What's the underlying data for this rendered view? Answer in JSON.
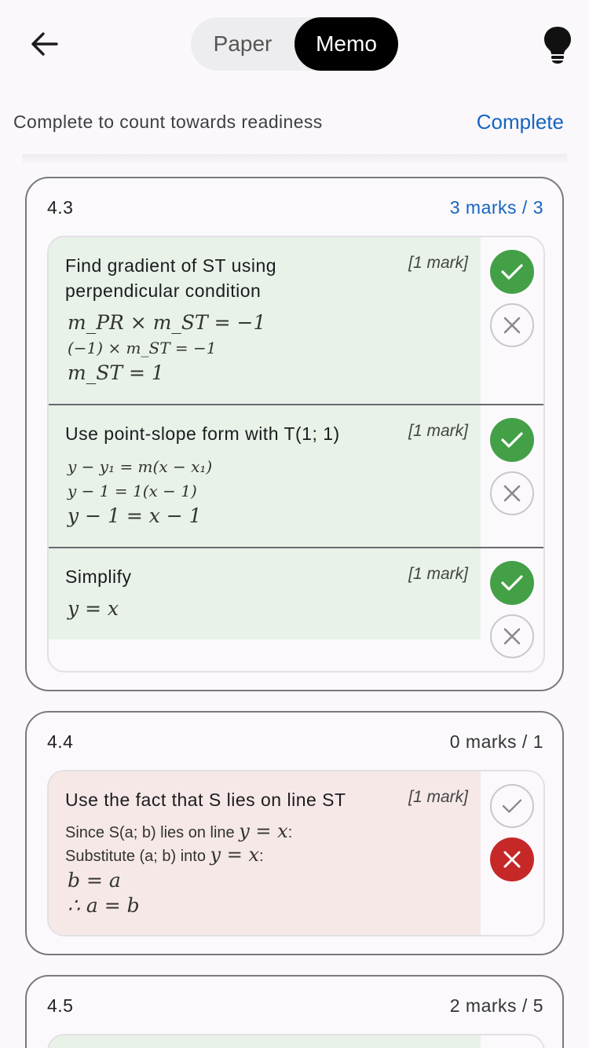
{
  "header": {
    "back_icon": "arrow-left-icon",
    "segments": [
      "Paper",
      "Memo"
    ],
    "active_segment": "Memo",
    "hint_icon": "lightbulb-icon"
  },
  "readiness": {
    "text": "Complete to count towards readiness",
    "action": "Complete"
  },
  "questions": [
    {
      "number": "4.3",
      "marks": "3 marks / 3",
      "steps": [
        {
          "title": "Find gradient of ST using perpendicular condition",
          "mark": "[1 mark]",
          "lines": [
            "m_PR × m_ST = −1",
            "(−1) × m_ST = −1",
            "m_ST = 1"
          ],
          "status": "correct"
        },
        {
          "title": "Use point-slope form with T(1; 1)",
          "mark": "[1 mark]",
          "lines": [
            "y − y₁ = m(x − x₁)",
            "y − 1 = 1(x − 1)",
            "y − 1 = x − 1"
          ],
          "status": "correct"
        },
        {
          "title": "Simplify",
          "mark": "[1 mark]",
          "lines": [
            "y = x"
          ],
          "status": "correct"
        }
      ]
    },
    {
      "number": "4.4",
      "marks": "0 marks / 1",
      "steps": [
        {
          "title": "Use the fact that S lies on line ST",
          "mark": "[1 mark]",
          "text_lines": [
            {
              "text": "Since S(a; b) lies on line",
              "math": "y = x",
              "suffix": ":"
            },
            {
              "text": "Substitute (a; b) into",
              "math": "y = x",
              "suffix": ":"
            }
          ],
          "lines": [
            "b = a",
            "∴ a = b"
          ],
          "status": "incorrect"
        }
      ]
    },
    {
      "number": "4.5",
      "marks": "2 marks / 5"
    }
  ],
  "colors": {
    "accent": "#1565c0",
    "correct": "#43a047",
    "incorrect": "#c62828",
    "correct_bg": "#e8f2e8",
    "incorrect_bg": "#f5e8e7"
  }
}
